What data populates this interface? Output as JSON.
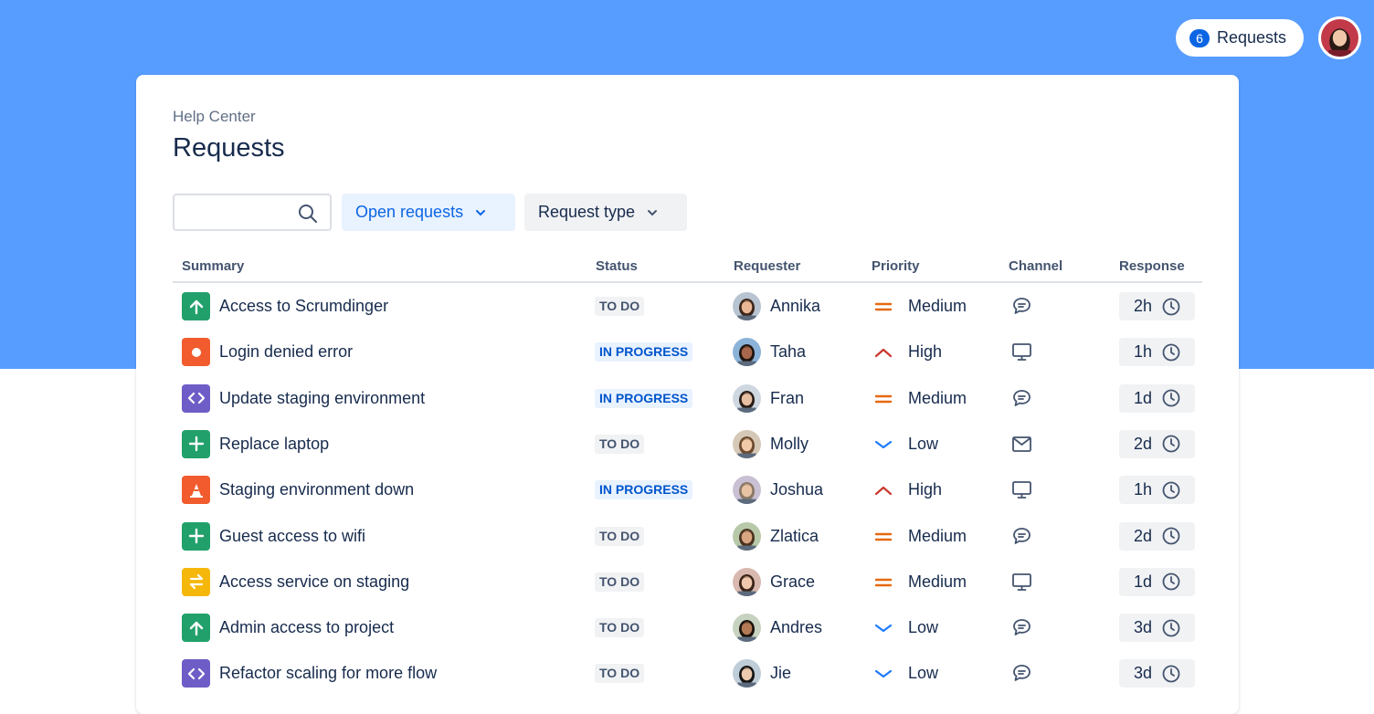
{
  "header": {
    "requests_count": "6",
    "requests_label": "Requests"
  },
  "page": {
    "breadcrumb": "Help Center",
    "title": "Requests"
  },
  "filters": {
    "search_value": "",
    "open_requests": "Open requests",
    "request_type": "Request type"
  },
  "columns": [
    "Summary",
    "Status",
    "Requester",
    "Priority",
    "Channel",
    "Response"
  ],
  "rows": [
    {
      "type": "arrow-up",
      "type_color": "#22a06b",
      "summary": "Access to Scrumdinger",
      "status": "TO DO",
      "requester": "Annika",
      "priority": "Medium",
      "channel": "chat",
      "response": "2h"
    },
    {
      "type": "bug",
      "type_color": "#f15b2d",
      "summary": "Login denied error",
      "status": "IN PROGRESS",
      "requester": "Taha",
      "priority": "High",
      "channel": "monitor",
      "response": "1h"
    },
    {
      "type": "code",
      "type_color": "#6e5dc6",
      "summary": "Update staging environment",
      "status": "IN PROGRESS",
      "requester": "Fran",
      "priority": "Medium",
      "channel": "chat",
      "response": "1d"
    },
    {
      "type": "plus",
      "type_color": "#22a06b",
      "summary": "Replace laptop",
      "status": "TO DO",
      "requester": "Molly",
      "priority": "Low",
      "channel": "mail",
      "response": "2d"
    },
    {
      "type": "cone",
      "type_color": "#f15b2d",
      "summary": "Staging environment down",
      "status": "IN PROGRESS",
      "requester": "Joshua",
      "priority": "High",
      "channel": "monitor",
      "response": "1h"
    },
    {
      "type": "plus",
      "type_color": "#22a06b",
      "summary": "Guest access to wifi",
      "status": "TO DO",
      "requester": "Zlatica",
      "priority": "Medium",
      "channel": "chat",
      "response": "2d"
    },
    {
      "type": "swap",
      "type_color": "#f5b70a",
      "summary": "Access service on staging",
      "status": "TO DO",
      "requester": "Grace",
      "priority": "Medium",
      "channel": "monitor",
      "response": "1d"
    },
    {
      "type": "arrow-up",
      "type_color": "#22a06b",
      "summary": "Admin access to project",
      "status": "TO DO",
      "requester": "Andres",
      "priority": "Low",
      "channel": "chat",
      "response": "3d"
    },
    {
      "type": "code",
      "type_color": "#6e5dc6",
      "summary": "Refactor scaling for more flow",
      "status": "TO DO",
      "requester": "Jie",
      "priority": "Low",
      "channel": "chat",
      "response": "3d"
    }
  ],
  "colors": {
    "banner": "#579dff",
    "priority_medium": "#e56910",
    "priority_high": "#c9372c",
    "priority_low": "#1d7afc"
  }
}
